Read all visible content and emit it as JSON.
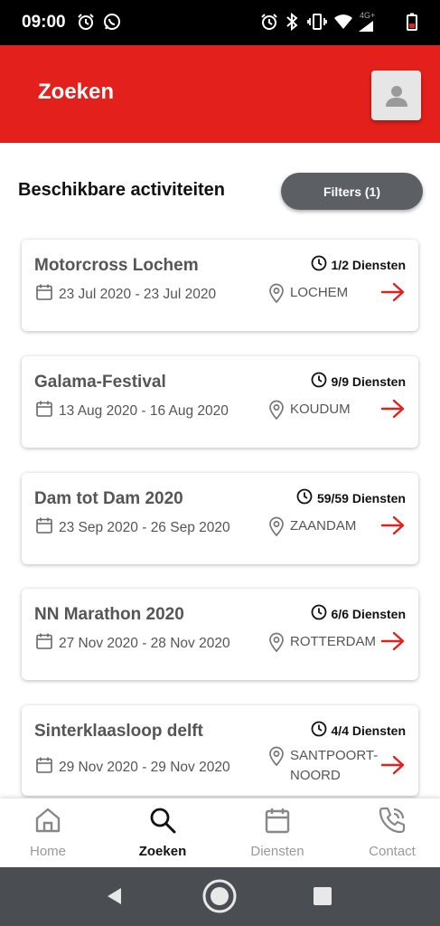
{
  "status_bar": {
    "time": "09:00",
    "left_icons": [
      "alarm-icon",
      "whatsapp-icon"
    ],
    "right_icons": [
      "alarm-icon",
      "bluetooth-icon",
      "vibrate-icon",
      "wifi-icon",
      "signal-icon",
      "battery-icon"
    ],
    "network": "4G+"
  },
  "header": {
    "title": "Zoeken",
    "avatar_icon": "user-icon"
  },
  "section": {
    "title": "Beschikbare activiteiten",
    "filters_label": "Filters (1)"
  },
  "activities": [
    {
      "title": "Motorcross Lochem",
      "services": "1/2 Diensten",
      "dates": "23 Jul 2020 - 23 Jul 2020",
      "location": [
        "LOCHEM"
      ]
    },
    {
      "title": "Galama-Festival",
      "services": "9/9 Diensten",
      "dates": "13 Aug 2020 - 16 Aug 2020",
      "location": [
        "KOUDUM"
      ]
    },
    {
      "title": "Dam tot Dam 2020",
      "services": "59/59 Diensten",
      "dates": "23 Sep 2020 - 26 Sep 2020",
      "location": [
        "ZAANDAM"
      ]
    },
    {
      "title": "NN Marathon 2020",
      "services": "6/6 Diensten",
      "dates": "27 Nov 2020 - 28 Nov 2020",
      "location": [
        "ROTTERDAM"
      ]
    },
    {
      "title": "Sinterklaasloop delft",
      "services": "4/4 Diensten",
      "dates": "29 Nov 2020 - 29 Nov 2020",
      "location": [
        "SANTPOORT-",
        "NOORD"
      ]
    }
  ],
  "bottom_nav": [
    {
      "label": "Home",
      "icon": "home-icon",
      "active": false
    },
    {
      "label": "Zoeken",
      "icon": "search-icon",
      "active": true
    },
    {
      "label": "Diensten",
      "icon": "calendar-icon",
      "active": false
    },
    {
      "label": "Contact",
      "icon": "phone-icon",
      "active": false
    }
  ],
  "system_nav": [
    "back-icon",
    "home-circle-icon",
    "recents-icon"
  ],
  "colors": {
    "brand_red": "#e3201c",
    "filters_button": "#5c5f64",
    "arrow_red": "#e3201c",
    "nav_active": "#111111",
    "nav_inactive": "#999999"
  }
}
